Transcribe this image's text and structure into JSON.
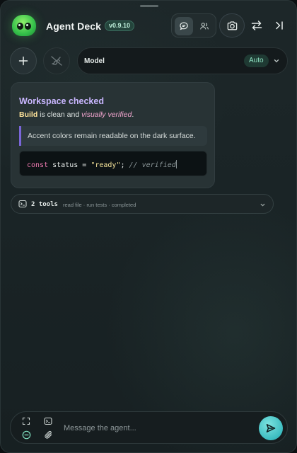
{
  "header": {
    "app_title": "Agent Deck",
    "version": "v0.9.10",
    "view_modes": [
      {
        "name": "chat",
        "icon": "chat-bubble-icon",
        "active": true
      },
      {
        "name": "agents",
        "icon": "users-icon",
        "active": false
      }
    ],
    "actions": [
      "camera-icon",
      "swap-icon",
      "collapse-panel-icon"
    ]
  },
  "toolbar": {
    "model_label": "Model",
    "model_value": "Auto"
  },
  "message": {
    "title": "Workspace checked",
    "line_bold": "Build",
    "line_mid": " is clean and ",
    "line_em": "visually verified",
    "line_end": ".",
    "quote": "Accent colors remain readable on the dark surface.",
    "code": {
      "keyword": "const",
      "identifier": " status",
      "operator": " = ",
      "string": "\"ready\"",
      "punct": ";",
      "comment": " // verified"
    }
  },
  "tools": {
    "count_label": "2 tools",
    "summary": "read file · run tests · completed"
  },
  "composer": {
    "placeholder": "Message the agent..."
  },
  "colors": {
    "accent_title": "#c9b6ff",
    "accent_bold": "#ffe39a",
    "accent_em": "#f4a6d0",
    "quote_bar": "#7a66d8",
    "send": "#3cbcc0",
    "version_badge": "#24453c"
  }
}
